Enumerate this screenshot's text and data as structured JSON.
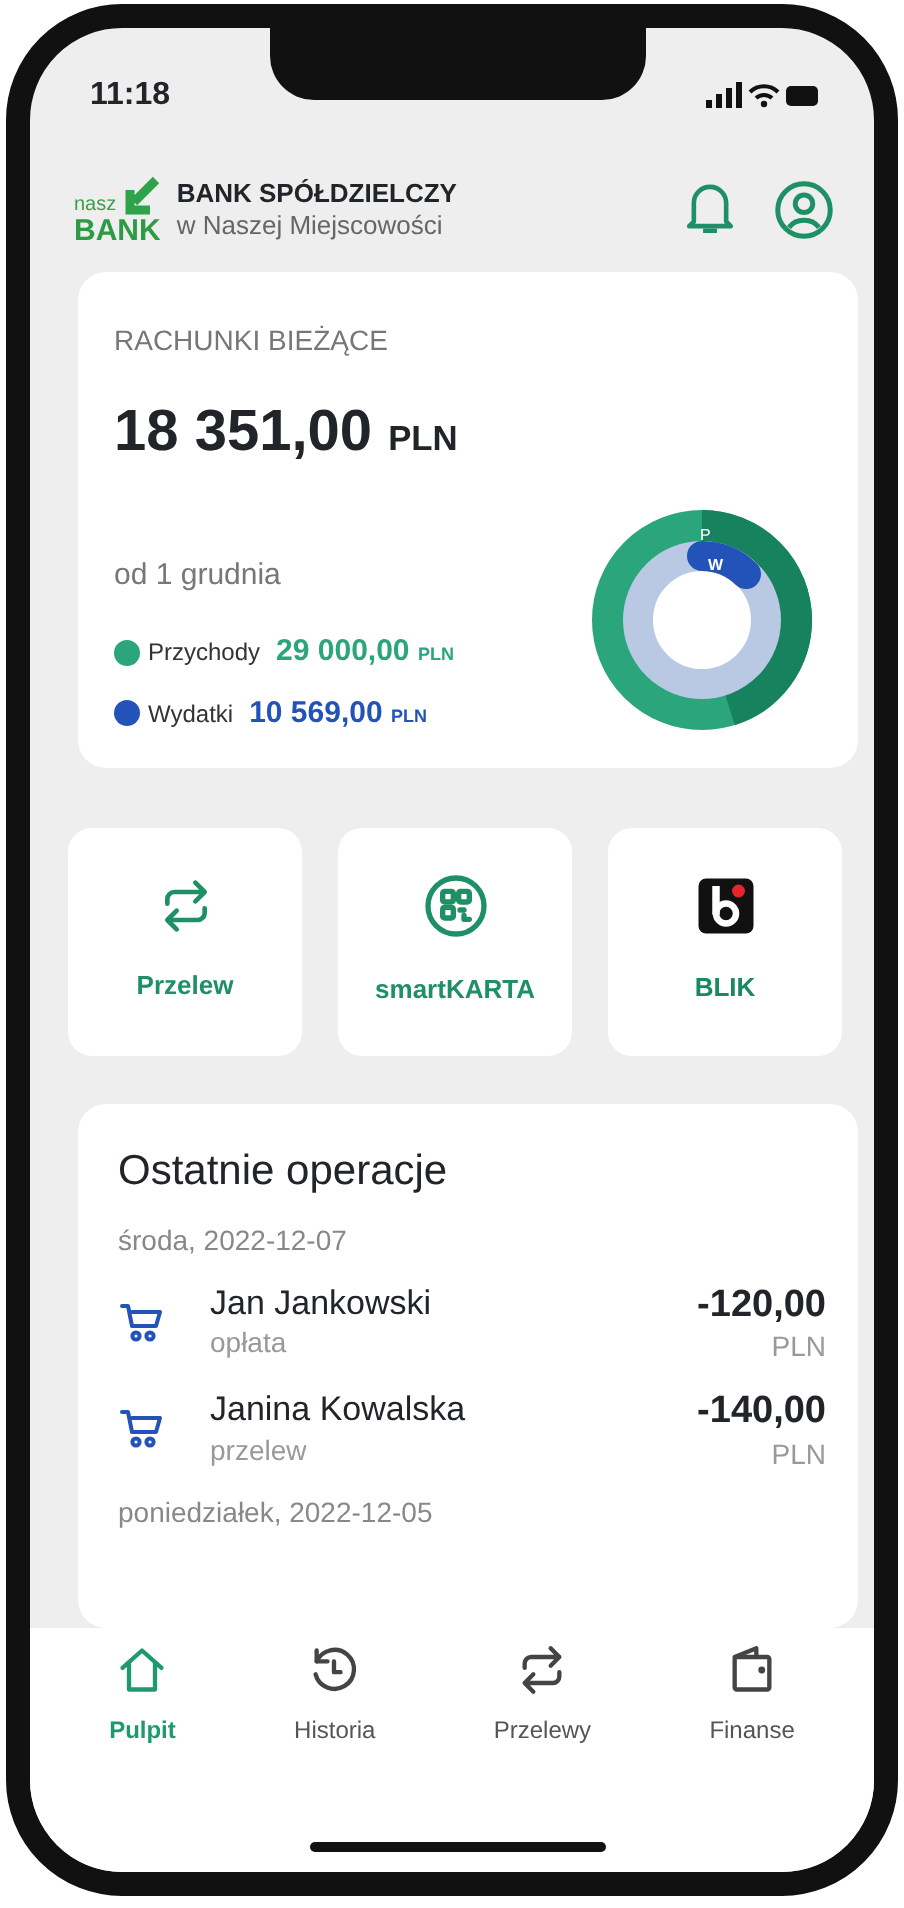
{
  "status_bar": {
    "time": "11:18"
  },
  "header": {
    "logo_small": "nasz",
    "logo_big": "BANK",
    "bank_name": "BANK SPÓŁDZIELCZY",
    "bank_subtitle": "w Naszej Miejscowości"
  },
  "accounts_card": {
    "title": "RACHUNKI BIEŻĄCE",
    "balance": "18 351,00",
    "balance_currency": "PLN",
    "period": "od 1 grudnia",
    "legend": [
      {
        "label": "Przychody",
        "amount": "29 000,00",
        "currency": "PLN",
        "color": "#2aa57c"
      },
      {
        "label": "Wydatki",
        "amount": "10 569,00",
        "currency": "PLN",
        "color": "#2353b8"
      }
    ],
    "donut_labels": [
      "P",
      "W"
    ]
  },
  "shortcuts": [
    {
      "kind": "transfer",
      "label": "Przelew"
    },
    {
      "kind": "qr",
      "label": "smartKARTA"
    },
    {
      "kind": "blik",
      "label": "BLIK"
    }
  ],
  "recent": {
    "title": "Ostatnie operacje",
    "groups": [
      {
        "date": "środa, 2022-12-07",
        "items": [
          {
            "name": "Jan Jankowski",
            "type": "opłata",
            "amount": "-120,00",
            "currency": "PLN"
          },
          {
            "name": "Janina Kowalska",
            "type": "przelew",
            "amount": "-140,00",
            "currency": "PLN"
          }
        ]
      },
      {
        "date": "poniedziałek, 2022-12-05"
      }
    ]
  },
  "tabs": [
    {
      "kind": "home",
      "label": "Pulpit",
      "selected": true
    },
    {
      "kind": "history",
      "label": "Historia",
      "selected": false
    },
    {
      "kind": "transfer",
      "label": "Przelewy",
      "selected": false
    },
    {
      "kind": "wallet",
      "label": "Finanse",
      "selected": false
    }
  ]
}
